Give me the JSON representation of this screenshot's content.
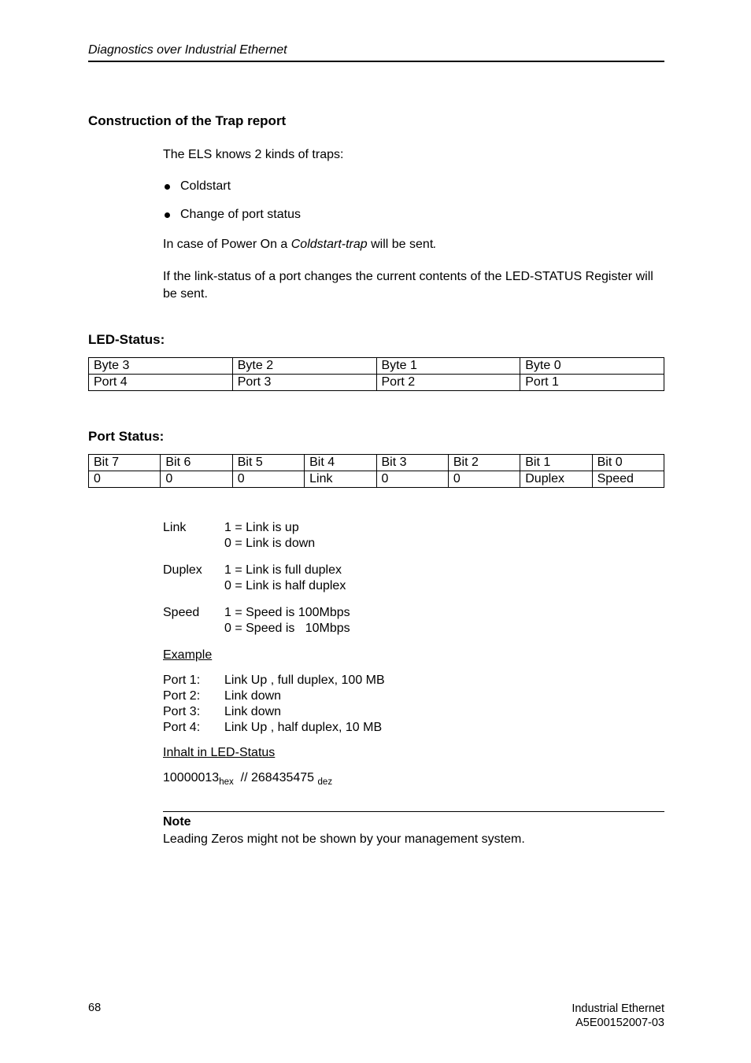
{
  "running_head": "Diagnostics over Industrial Ethernet",
  "s1": {
    "title": "Construction of the Trap report",
    "intro": "The ELS knows 2 kinds of traps:",
    "bullets": [
      "Coldstart",
      "Change of port status"
    ],
    "p1_a": "In case of Power On a ",
    "p1_i": "Coldstart-trap",
    "p1_b": " will be sent",
    "p1_ip": ".",
    "p2": "If the link-status of a port changes the current contents of the LED-STATUS Register will be sent."
  },
  "led": {
    "title": "LED-Status:",
    "row1": [
      "Byte 3",
      "Byte 2",
      "Byte 1",
      "Byte 0"
    ],
    "row2": [
      "Port 4",
      "Port 3",
      "Port 2",
      "Port 1"
    ]
  },
  "port": {
    "title": "Port Status:",
    "row1": [
      "Bit 7",
      "Bit 6",
      "Bit 5",
      "Bit 4",
      "Bit 3",
      "Bit 2",
      "Bit 1",
      "Bit 0"
    ],
    "row2": [
      "0",
      "0",
      "0",
      "Link",
      "0",
      "0",
      "Duplex",
      "Speed"
    ]
  },
  "defs": {
    "link": {
      "label": "Link",
      "l1": "1 = Link is up",
      "l2": "0 = Link is down"
    },
    "duplex": {
      "label": "Duplex",
      "l1": "1 = Link is full duplex",
      "l2": "0 = Link is half duplex"
    },
    "speed": {
      "label": "Speed",
      "l1": "1 = Speed is 100Mbps",
      "l2": "0 = Speed is   10Mbps"
    }
  },
  "example": {
    "title": "Example",
    "rows": [
      {
        "label": "Port 1:",
        "val": "Link Up , full duplex, 100 MB"
      },
      {
        "label": "Port 2:",
        "val": "Link down"
      },
      {
        "label": "Port 3:",
        "val": "Link down"
      },
      {
        "label": "Port 4:",
        "val": "Link Up , half duplex, 10 MB"
      }
    ]
  },
  "inhalt": {
    "title": "Inhalt in LED-Status",
    "val_a": "10000013",
    "sub_a": "hex",
    "mid": "  // 268435475 ",
    "sub_b": "dez"
  },
  "note": {
    "title": "Note",
    "body": "Leading Zeros might not be shown by your management system."
  },
  "footer": {
    "page": "68",
    "r1": "Industrial Ethernet",
    "r2": "A5E00152007-03"
  }
}
